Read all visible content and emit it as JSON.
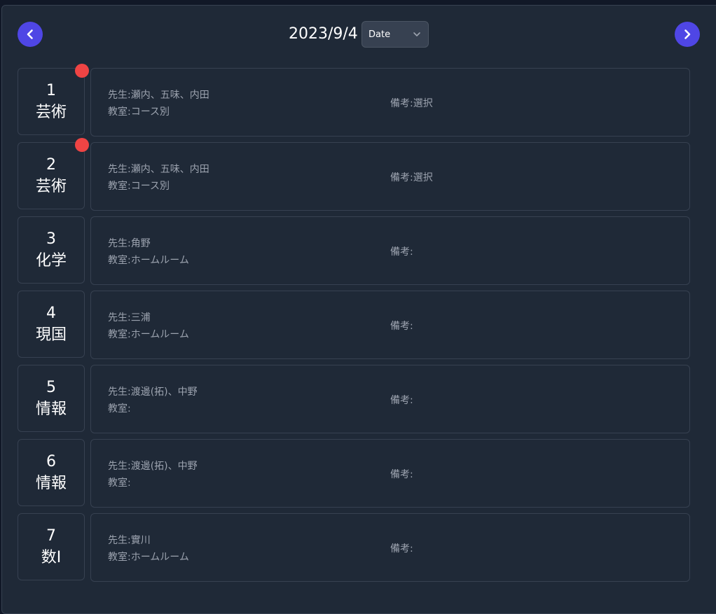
{
  "header": {
    "date": "2023/9/4",
    "select_value": "Date",
    "prev_icon": "chevron-left-icon",
    "next_icon": "chevron-right-icon"
  },
  "colors": {
    "accent": "#4f46e5",
    "notification": "#ef4444",
    "panel": "#1f2937",
    "border": "#374151",
    "muted_text": "#9ca3af"
  },
  "periods": [
    {
      "number": "1",
      "subject": "芸術",
      "teacher": "先生:瀬内、五味、内田",
      "room": "教室:コース別",
      "note": "備考:選択",
      "has_dot": true
    },
    {
      "number": "2",
      "subject": "芸術",
      "teacher": "先生:瀬内、五味、内田",
      "room": "教室:コース別",
      "note": "備考:選択",
      "has_dot": true
    },
    {
      "number": "3",
      "subject": "化学",
      "teacher": "先生:角野",
      "room": "教室:ホームルーム",
      "note": "備考:",
      "has_dot": false
    },
    {
      "number": "4",
      "subject": "現国",
      "teacher": "先生:三浦",
      "room": "教室:ホームルーム",
      "note": "備考:",
      "has_dot": false
    },
    {
      "number": "5",
      "subject": "情報",
      "teacher": "先生:渡邊(拓)、中野",
      "room": "教室:",
      "note": "備考:",
      "has_dot": false
    },
    {
      "number": "6",
      "subject": "情報",
      "teacher": "先生:渡邊(拓)、中野",
      "room": "教室:",
      "note": "備考:",
      "has_dot": false
    },
    {
      "number": "7",
      "subject": "数Ⅰ",
      "teacher": "先生:實川",
      "room": "教室:ホームルーム",
      "note": "備考:",
      "has_dot": false
    }
  ]
}
